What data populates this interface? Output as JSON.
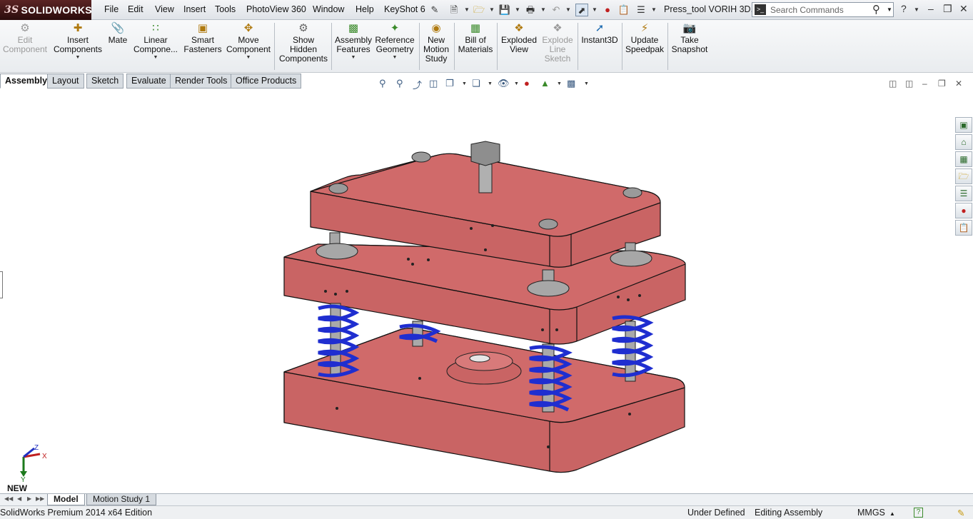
{
  "app": {
    "logo_text": "SOLIDWORKS",
    "logo_mark": "3S"
  },
  "menu": [
    "File",
    "Edit",
    "View",
    "Insert",
    "Tools",
    "PhotoView 360",
    "Window",
    "Help",
    "KeyShot 6"
  ],
  "document_title": "Press_tool VORIH 3D...",
  "search": {
    "placeholder": "Search Commands"
  },
  "commands": [
    {
      "label": "Edit\nComponent",
      "icon": "edit-component-icon",
      "enabled": false
    },
    {
      "label": "Insert\nComponents",
      "icon": "insert-components-icon",
      "enabled": true
    },
    {
      "label": "Mate",
      "icon": "mate-icon",
      "enabled": true
    },
    {
      "label": "Linear\nCompone...",
      "icon": "linear-pattern-icon",
      "enabled": true
    },
    {
      "label": "Smart\nFasteners",
      "icon": "smart-fasteners-icon",
      "enabled": true
    },
    {
      "label": "Move\nComponent",
      "icon": "move-component-icon",
      "enabled": true
    },
    {
      "label": "Show\nHidden\nComponents",
      "icon": "show-hidden-icon",
      "enabled": true
    },
    {
      "label": "Assembly\nFeatures",
      "icon": "assembly-features-icon",
      "enabled": true
    },
    {
      "label": "Reference\nGeometry",
      "icon": "reference-geometry-icon",
      "enabled": true
    },
    {
      "label": "New\nMotion\nStudy",
      "icon": "motion-study-icon",
      "enabled": true
    },
    {
      "label": "Bill of\nMaterials",
      "icon": "bill-of-materials-icon",
      "enabled": true
    },
    {
      "label": "Exploded\nView",
      "icon": "exploded-view-icon",
      "enabled": true
    },
    {
      "label": "Explode\nLine\nSketch",
      "icon": "explode-line-sketch-icon",
      "enabled": false
    },
    {
      "label": "Instant3D",
      "icon": "instant3d-icon",
      "enabled": true
    },
    {
      "label": "Update\nSpeedpak",
      "icon": "speedpak-icon",
      "enabled": true
    },
    {
      "label": "Take\nSnapshot",
      "icon": "snapshot-icon",
      "enabled": true
    }
  ],
  "tabs": [
    "Assembly",
    "Layout",
    "Sketch",
    "Evaluate",
    "Render Tools",
    "Office Products"
  ],
  "bottom_tabs": [
    "Model",
    "Motion Study 1"
  ],
  "triad": {
    "x": "X",
    "y": "Y",
    "z": "Z",
    "view_label": "NEW"
  },
  "status": {
    "edition": "SolidWorks Premium 2014 x64 Edition",
    "state": "Under Defined",
    "mode": "Editing Assembly",
    "units": "MMGS"
  },
  "colors": {
    "plate": "#c96464",
    "spring": "#1f2ed0",
    "rod": "#a9a9a9",
    "logo_bg": "#4a1b1b"
  }
}
